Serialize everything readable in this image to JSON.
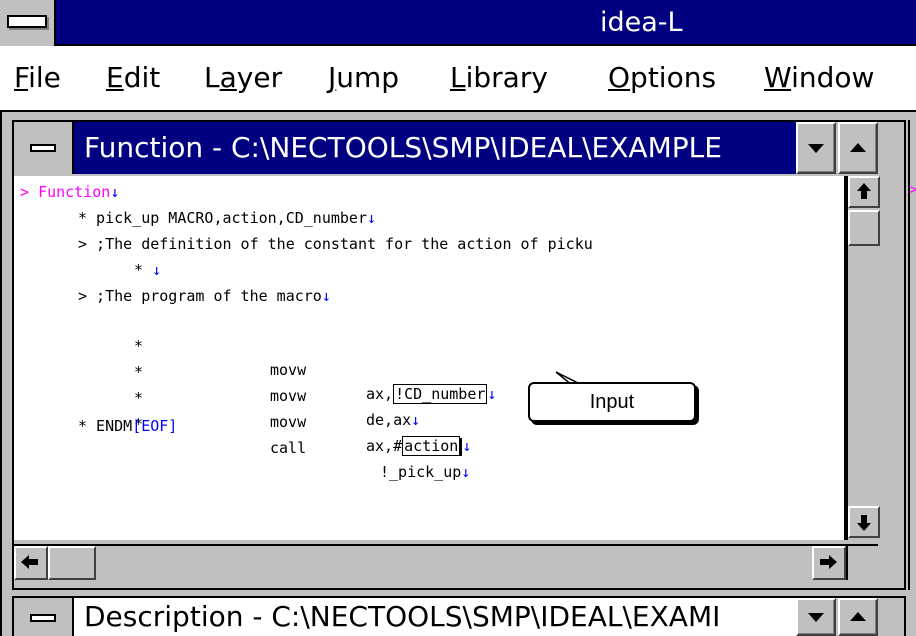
{
  "app": {
    "title": "idea-L"
  },
  "menu": [
    {
      "mnemonic": "F",
      "rest": "ile"
    },
    {
      "mnemonic": "E",
      "rest": "dit"
    },
    {
      "pre": "L",
      "mnemonic": "a",
      "rest": "yer"
    },
    {
      "mnemonic": "J",
      "rest": "ump"
    },
    {
      "mnemonic": "L",
      "rest": "ibrary"
    },
    {
      "mnemonic": "O",
      "rest": "ptions"
    },
    {
      "mnemonic": "W",
      "rest": "indow"
    }
  ],
  "function_window": {
    "title": "Function - C:\\NECTOOLS\\SMP\\IDEAL\\EXAMPLE",
    "lines": {
      "l1_marker": ">",
      "l1_text": "Function",
      "l2": "* pick_up MACRO,action,CD_number",
      "l3": "> ;The definition of the constant for the action of picku",
      "l4": "*",
      "l5": "> ;The program of the macro",
      "l6_star": "*",
      "l6_op": "movw",
      "l6_arg_pre": "ax,",
      "l6_arg_box": "!CD_number",
      "l7_star": "*",
      "l7_op": "movw",
      "l7_arg": "de,ax",
      "l8_star": "*",
      "l8_op": "movw",
      "l8_arg_pre": "ax,#",
      "l8_arg_box": "action",
      "l9_star": "*",
      "l9_op": "call",
      "l9_arg": "!_pick_up",
      "l10_text": "* ENDM",
      "l10_eof": "[EOF]"
    },
    "callout": "Input"
  },
  "right_window": {
    "marker": ">"
  },
  "description_window": {
    "title": "Description - C:\\NECTOOLS\\SMP\\IDEAL\\EXAMI"
  },
  "colors": {
    "titlebar_active": "#000080",
    "workspace": "#c0c0c0",
    "marker_magenta": "#ff00ff",
    "linebreak_blue": "#0000ff"
  },
  "icons": {
    "system_menu": "minus-bar-icon",
    "line_break": "down-arrow-mark-icon"
  }
}
